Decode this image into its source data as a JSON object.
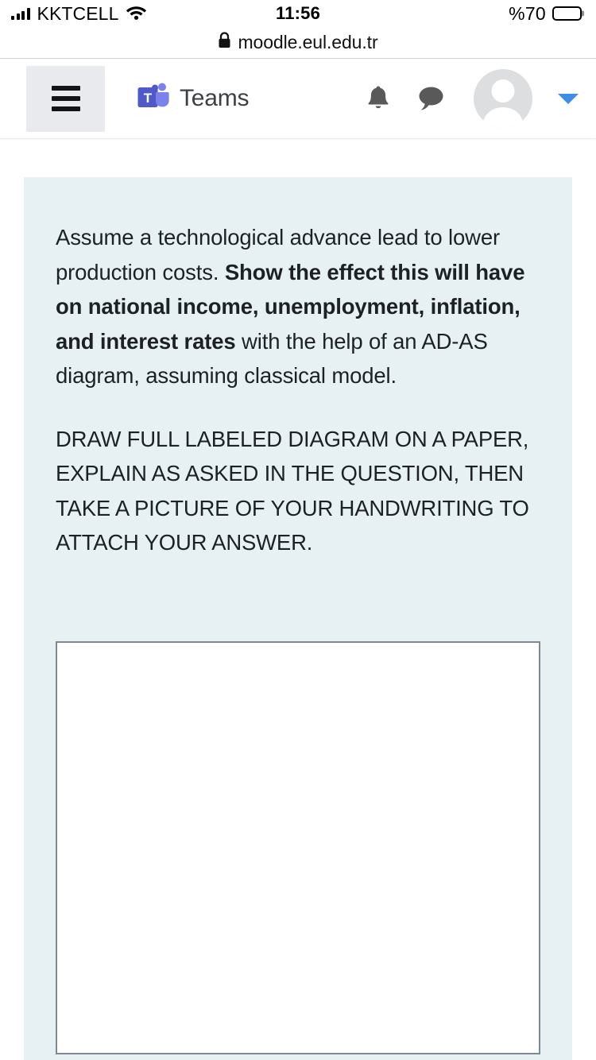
{
  "status_bar": {
    "carrier": "KKTCELL",
    "signal_icon": "signal-bars-icon",
    "wifi_icon": "wifi-icon",
    "time": "11:56",
    "battery_label": "%70",
    "battery_level_pct": 70,
    "battery_icon": "battery-icon"
  },
  "browser": {
    "lock_icon": "lock-icon",
    "url": "moodle.eul.edu.tr"
  },
  "navbar": {
    "menu_button_icon": "hamburger-menu-icon",
    "brand_logo_icon": "microsoft-teams-logo-icon",
    "brand_label": "Teams",
    "notifications_icon": "bell-icon",
    "messages_icon": "chat-bubble-icon",
    "avatar_icon": "user-avatar-icon",
    "user_menu_caret_icon": "caret-down-icon"
  },
  "question": {
    "intro_part1": "Assume a technological advance lead to lower production costs. ",
    "emphasis": "Show the effect this will have on national income, unemployment, inflation, and interest rates",
    "intro_part2": " with the help of an AD-AS diagram, assuming classical model.",
    "instructions": "DRAW FULL LABELED DIAGRAM ON A PAPER, EXPLAIN AS ASKED IN THE QUESTION, THEN TAKE A PICTURE OF YOUR HANDWRITING TO ATTACH YOUR ANSWER."
  },
  "colors": {
    "card_background": "#e7f1f3",
    "answer_box_border": "#7e8a93",
    "caret_blue": "#3d8ee8",
    "teams_purple": "#5059c9",
    "hamburger_button_bg": "#e8eaed"
  }
}
